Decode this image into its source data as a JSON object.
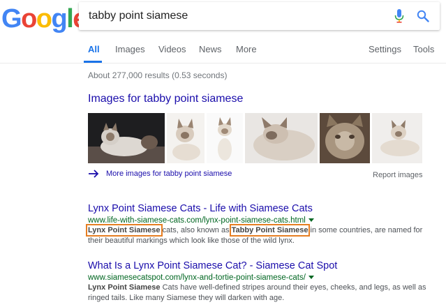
{
  "logo": {
    "letters": [
      "G",
      "o",
      "o",
      "g",
      "l",
      "e"
    ]
  },
  "search": {
    "query": "tabby point siamese"
  },
  "tabs": {
    "all": "All",
    "images": "Images",
    "videos": "Videos",
    "news": "News",
    "more": "More",
    "settings": "Settings",
    "tools": "Tools"
  },
  "stats": "About 277,000 results (0.53 seconds)",
  "images_block": {
    "heading": "Images for tabby point siamese",
    "more_link": "More images for tabby point siamese",
    "report": "Report images"
  },
  "results": [
    {
      "title": "Lynx Point Siamese Cats - Life with Siamese Cats",
      "url": "www.life-with-siamese-cats.com/lynx-point-siamese-cats.html",
      "snippet_bold_1": "Lynx Point Siamese",
      "snippet_text_1": " cats, also known as ",
      "snippet_bold_2": "Tabby Point Siamese",
      "snippet_text_2": " in some countries, are named for their beautiful markings which look like those of the wild lynx."
    },
    {
      "title": "What Is a Lynx Point Siamese Cat? - Siamese Cat Spot",
      "url": "www.siamesecatspot.com/lynx-and-tortie-point-siamese-cats/",
      "snippet_bold_1": "Lynx Point Siamese",
      "snippet_text_1": " Cats have well-defined stripes around their eyes, cheeks, and legs, as well as ringed tails. Like many Siamese they will darken with age."
    }
  ],
  "colors": {
    "blue": "#4285f4",
    "red": "#ea4335",
    "yellow": "#fbbc05",
    "green": "#34a853",
    "link": "#1a0dab",
    "url": "#006621",
    "highlight": "#e67e22"
  },
  "icons": [
    "microphone-icon",
    "search-icon",
    "arrow-right-icon",
    "caret-down-icon"
  ]
}
